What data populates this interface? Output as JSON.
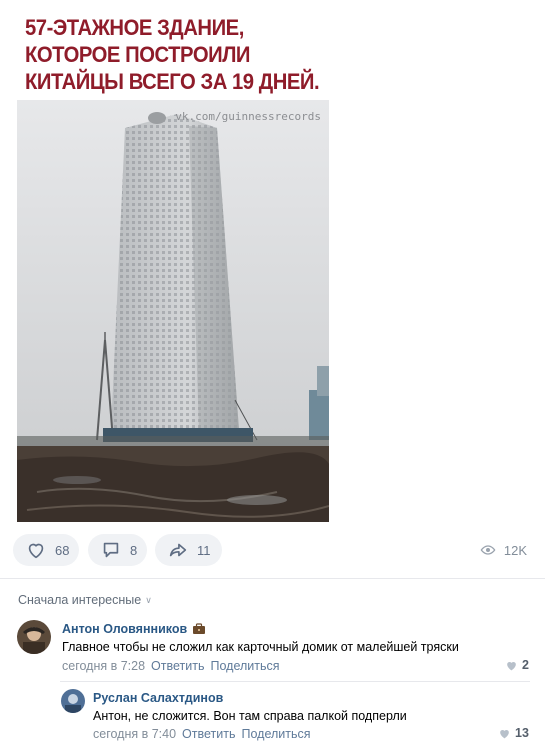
{
  "meme": {
    "title": "57-ЭТАЖНОЕ ЗДАНИЕ, КОТОРОЕ ПОСТРОИЛИ КИТАЙЦЫ ВСЕГО ЗА 19 ДНЕЙ.",
    "watermark": "vk.com/guinnessrecords"
  },
  "actions": {
    "likes": "68",
    "comments": "8",
    "shares": "11",
    "views": "12K"
  },
  "sort": {
    "label": "Сначала интересные"
  },
  "comments": [
    {
      "author": "Антон Оловянников",
      "text": "Главное чтобы не сложил как карточный домик от малейшей тряски",
      "time": "сегодня в 7:28",
      "reply_label": "Ответить",
      "share_label": "Поделиться",
      "likes": "2"
    },
    {
      "author": "Руслан Салахтдинов",
      "text": "Антон, не сложится. Вон там справа палкой подперли",
      "time": "сегодня в 7:40",
      "reply_label": "Ответить",
      "share_label": "Поделиться",
      "likes": "13"
    }
  ],
  "colors": {
    "title": "#8f1c2a",
    "link": "#2a5885",
    "muted": "#828d99",
    "pill_bg": "#f0f2f5"
  }
}
